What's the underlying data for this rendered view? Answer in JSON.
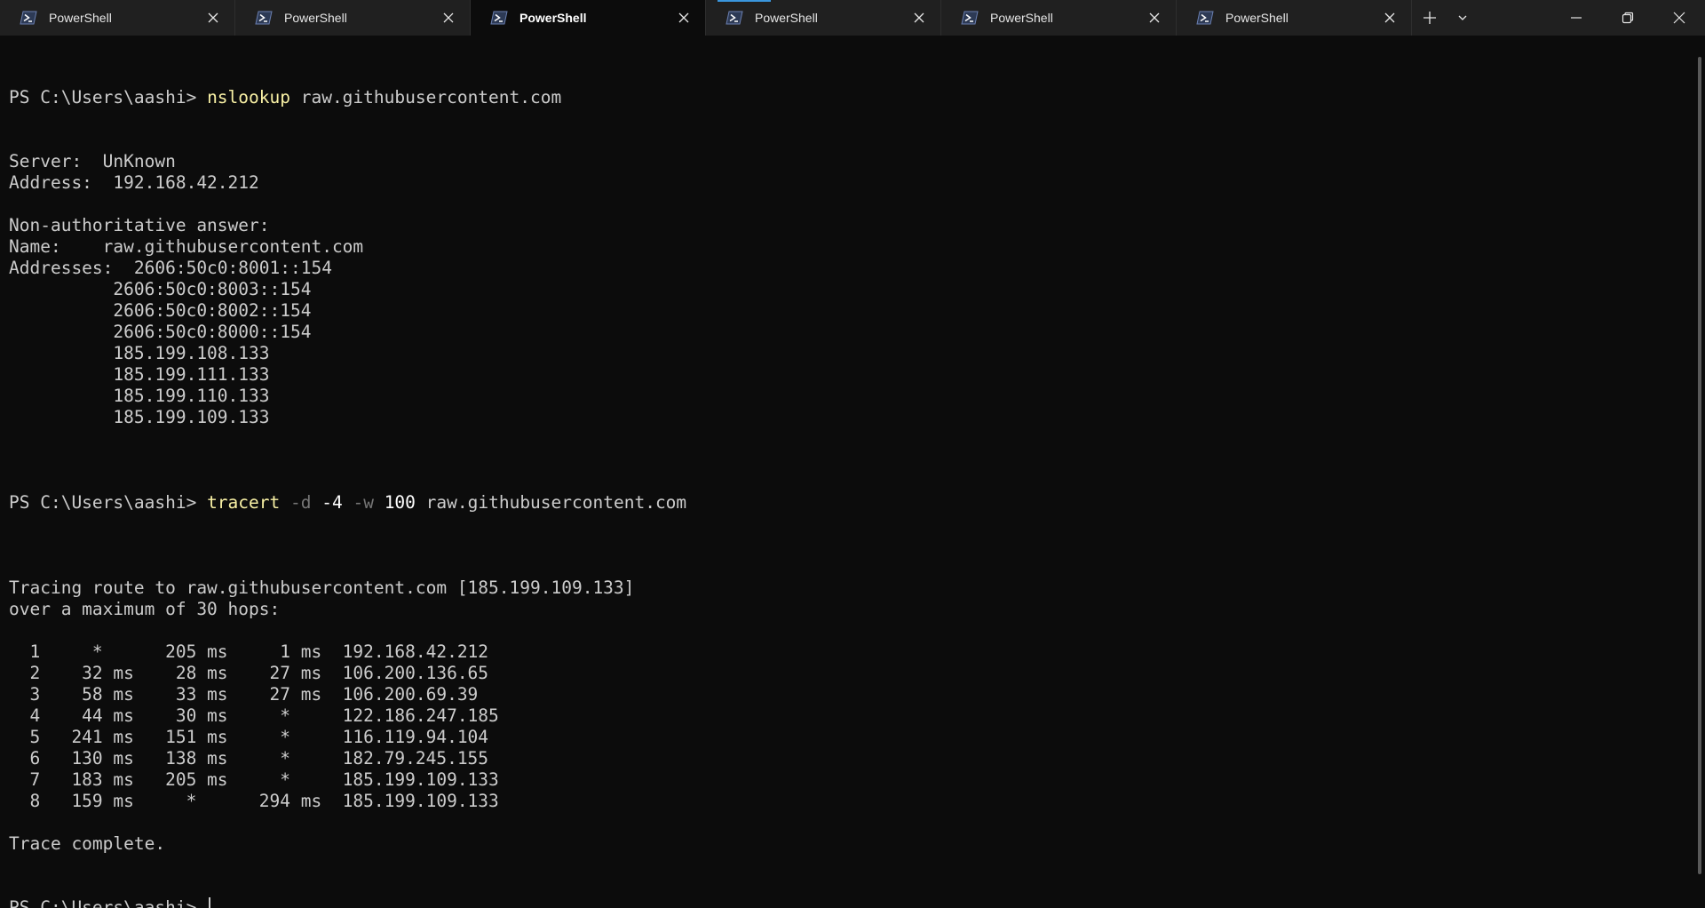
{
  "tabs": [
    {
      "label": "PowerShell",
      "active": false
    },
    {
      "label": "PowerShell",
      "active": false
    },
    {
      "label": "PowerShell",
      "active": true
    },
    {
      "label": "PowerShell",
      "active": false
    },
    {
      "label": "PowerShell",
      "active": false
    },
    {
      "label": "PowerShell",
      "active": false
    }
  ],
  "icons": {
    "tab": "powershell-icon",
    "close": "close-icon",
    "new_tab": "plus-icon",
    "dropdown": "chevron-down-icon",
    "minimize": "minimize-icon",
    "restore": "restore-icon",
    "window_close": "close-icon"
  },
  "colors": {
    "background": "#0c0c0c",
    "tabbar": "#202020",
    "text": "#cccccc",
    "command": "#f9f1a5",
    "flag": "#767676"
  },
  "terminal": {
    "prompt": "PS C:\\Users\\aashi> ",
    "nslookup": {
      "command": "nslookup",
      "args": " raw.githubusercontent.com",
      "output": [
        "Server:  UnKnown",
        "Address:  192.168.42.212",
        "",
        "Non-authoritative answer:",
        "Name:    raw.githubusercontent.com",
        "Addresses:  2606:50c0:8001::154",
        "          2606:50c0:8003::154",
        "          2606:50c0:8002::154",
        "          2606:50c0:8000::154",
        "          185.199.108.133",
        "          185.199.111.133",
        "          185.199.110.133",
        "          185.199.109.133",
        ""
      ]
    },
    "tracert": {
      "command": "tracert",
      "flag_d": " -d",
      "flag_4": " -4",
      "flag_w": " -w",
      "wait_value": " 100",
      "target": " raw.githubusercontent.com",
      "output": [
        "",
        "Tracing route to raw.githubusercontent.com [185.199.109.133]",
        "over a maximum of 30 hops:",
        "",
        "  1     *      205 ms     1 ms  192.168.42.212",
        "  2    32 ms    28 ms    27 ms  106.200.136.65",
        "  3    58 ms    33 ms    27 ms  106.200.69.39",
        "  4    44 ms    30 ms     *     122.186.247.185",
        "  5   241 ms   151 ms     *     116.119.94.104",
        "  6   130 ms   138 ms     *     182.79.245.155",
        "  7   183 ms   205 ms     *     185.199.109.133",
        "  8   159 ms     *      294 ms  185.199.109.133",
        "",
        "Trace complete."
      ]
    }
  }
}
